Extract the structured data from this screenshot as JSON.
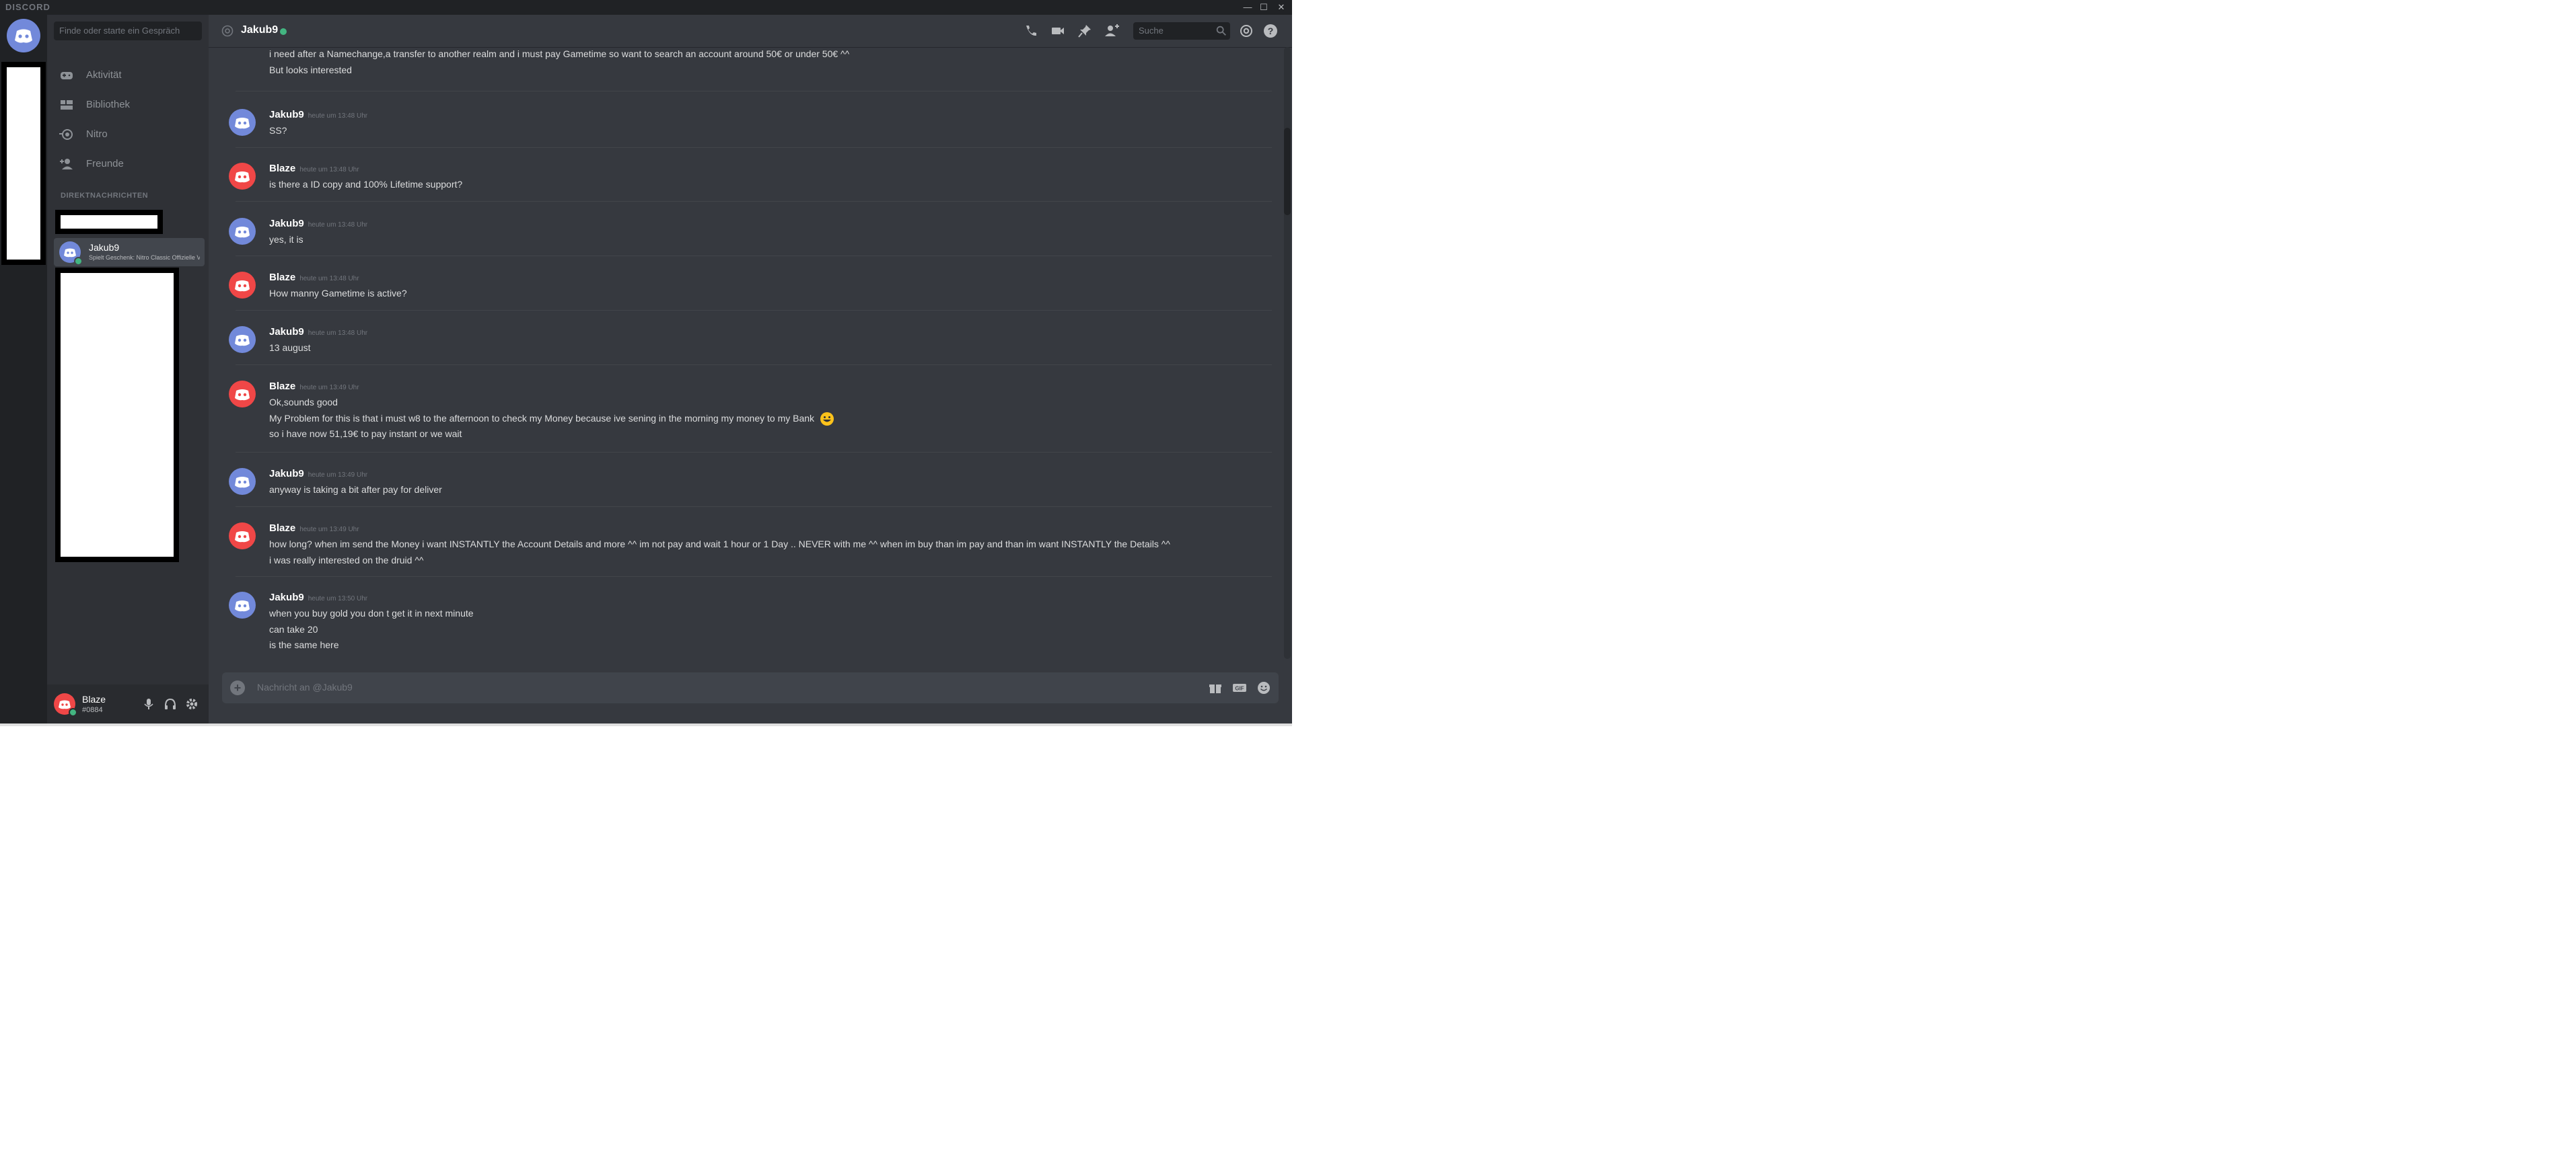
{
  "titlebar": {
    "brand": "DISCORD",
    "min": "—",
    "max": "☐",
    "close": "✕"
  },
  "sidebar": {
    "search_placeholder": "Finde oder starte ein Gespräch",
    "nav": [
      {
        "label": "Aktivität",
        "icon": "gamepad-icon"
      },
      {
        "label": "Bibliothek",
        "icon": "library-icon"
      },
      {
        "label": "Nitro",
        "icon": "nitro-icon"
      },
      {
        "label": "Freunde",
        "icon": "friends-icon"
      }
    ],
    "dm_header": "DIREKTNACHRICHTEN",
    "dm": {
      "name": "Jakub9",
      "subtitle": "Spielt Geschenk: Nitro Classic Offizielle Vorteile"
    }
  },
  "user": {
    "name": "Blaze",
    "tag": "#0884"
  },
  "header": {
    "channel": "Jakub9",
    "search_placeholder": "Suche"
  },
  "messages": [
    {
      "author": "",
      "timestamp": "",
      "color": "#7289da",
      "lines": [
        "i need after a Namechange,a transfer to another realm and i must pay Gametime so want to search an account around 50€ or under 50€ ^^",
        "But looks interested"
      ]
    },
    {
      "author": "Jakub9",
      "timestamp": "heute um 13:48 Uhr",
      "color": "#7289da",
      "lines": [
        "SS?"
      ]
    },
    {
      "author": "Blaze",
      "timestamp": "heute um 13:48 Uhr",
      "color": "#f04747",
      "lines": [
        "is there a ID copy and 100% Lifetime support?"
      ]
    },
    {
      "author": "Jakub9",
      "timestamp": "heute um 13:48 Uhr",
      "color": "#7289da",
      "lines": [
        "yes, it is"
      ]
    },
    {
      "author": "Blaze",
      "timestamp": "heute um 13:48 Uhr",
      "color": "#f04747",
      "lines": [
        "How manny Gametime is active?"
      ]
    },
    {
      "author": "Jakub9",
      "timestamp": "heute um 13:48 Uhr",
      "color": "#7289da",
      "lines": [
        "13 august"
      ]
    },
    {
      "author": "Blaze",
      "timestamp": "heute um 13:49 Uhr",
      "color": "#f04747",
      "lines": [
        "Ok,sounds good",
        "My Problem for this is that i must w8 to the afternoon to check my Money because ive sening in the morning my money to my Bank",
        "so i have now 51,19€ to pay instant or we wait"
      ]
    },
    {
      "author": "Jakub9",
      "timestamp": "heute um 13:49 Uhr",
      "color": "#7289da",
      "lines": [
        "anyway is taking a bit after pay for deliver"
      ]
    },
    {
      "author": "Blaze",
      "timestamp": "heute um 13:49 Uhr",
      "color": "#f04747",
      "lines": [
        "how long? when im send the Money i want INSTANTLY the Account Details and more ^^ im not pay and wait 1 hour or 1 Day .. NEVER with me ^^ when im buy than im pay and than im want INSTANTLY the Details ^^",
        "i was really interested on the druid ^^"
      ]
    },
    {
      "author": "Jakub9",
      "timestamp": "heute um 13:50 Uhr",
      "color": "#7289da",
      "lines": [
        "when you buy gold you don t get it in next minute",
        "can take 20",
        "is the same here"
      ]
    }
  ],
  "composer": {
    "placeholder": "Nachricht an @Jakub9"
  },
  "colors": {
    "blurple": "#7289da",
    "red": "#f04747",
    "online": "#43b581"
  }
}
